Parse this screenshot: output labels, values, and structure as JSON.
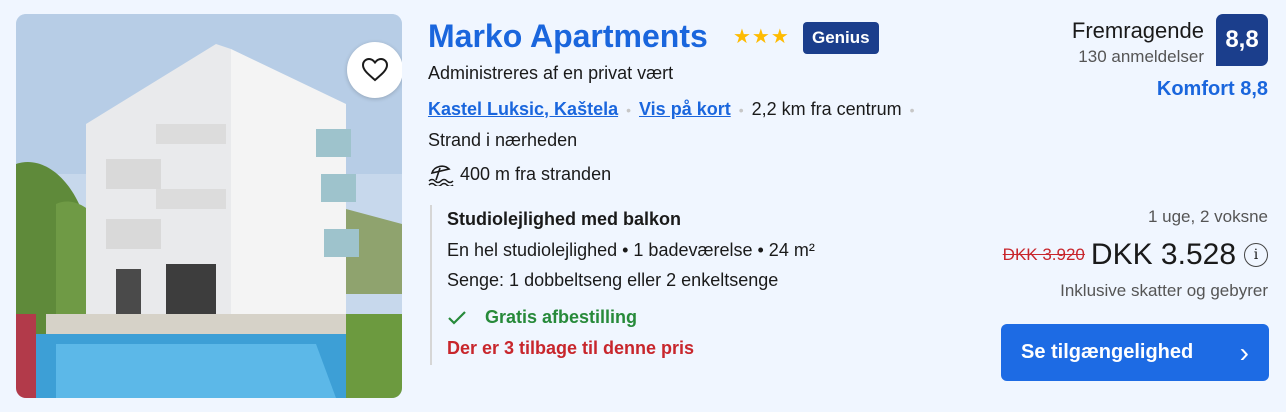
{
  "hotel": {
    "name": "Marko Apartments",
    "stars": "★★★",
    "genius_label": "Genius",
    "managed_by": "Administreres af en privat vært",
    "location_link": "Kastel Luksic, Kaštela",
    "map_link": "Vis på kort",
    "distance_center": "2,2 km fra centrum",
    "beach_nearby": "Strand i nærheden",
    "beach_distance": "400 m fra stranden"
  },
  "room": {
    "title": "Studiolejlighed med balkon",
    "description": "En hel studiolejlighed • 1 badeværelse • 24 m²",
    "beds": "Senge: 1 dobbeltseng eller 2 enkeltsenge",
    "cancellation": "Gratis afbestilling",
    "availability": "Der er 3 tilbage til denne pris"
  },
  "review": {
    "word": "Fremragende",
    "count": "130 anmeldelser",
    "score": "8,8",
    "comfort": "Komfort 8,8"
  },
  "price": {
    "stay": "1 uge, 2 voksne",
    "old": "DKK 3.920",
    "new": "DKK 3.528",
    "info_icon_glyph": "i",
    "taxes": "Inklusive skatter og gebyrer"
  },
  "cta": {
    "label": "Se tilgængelighed",
    "chevron": "›"
  },
  "icons": {
    "favorite": "heart-icon",
    "beach": "beach-umbrella-icon",
    "check": "check-icon",
    "info": "info-icon"
  },
  "colors": {
    "link": "#1a66dd",
    "brand_dark": "#1b3e8c",
    "green": "#278a3a",
    "red": "#c8262c",
    "cta": "#1d6be4",
    "star": "#febb02"
  }
}
